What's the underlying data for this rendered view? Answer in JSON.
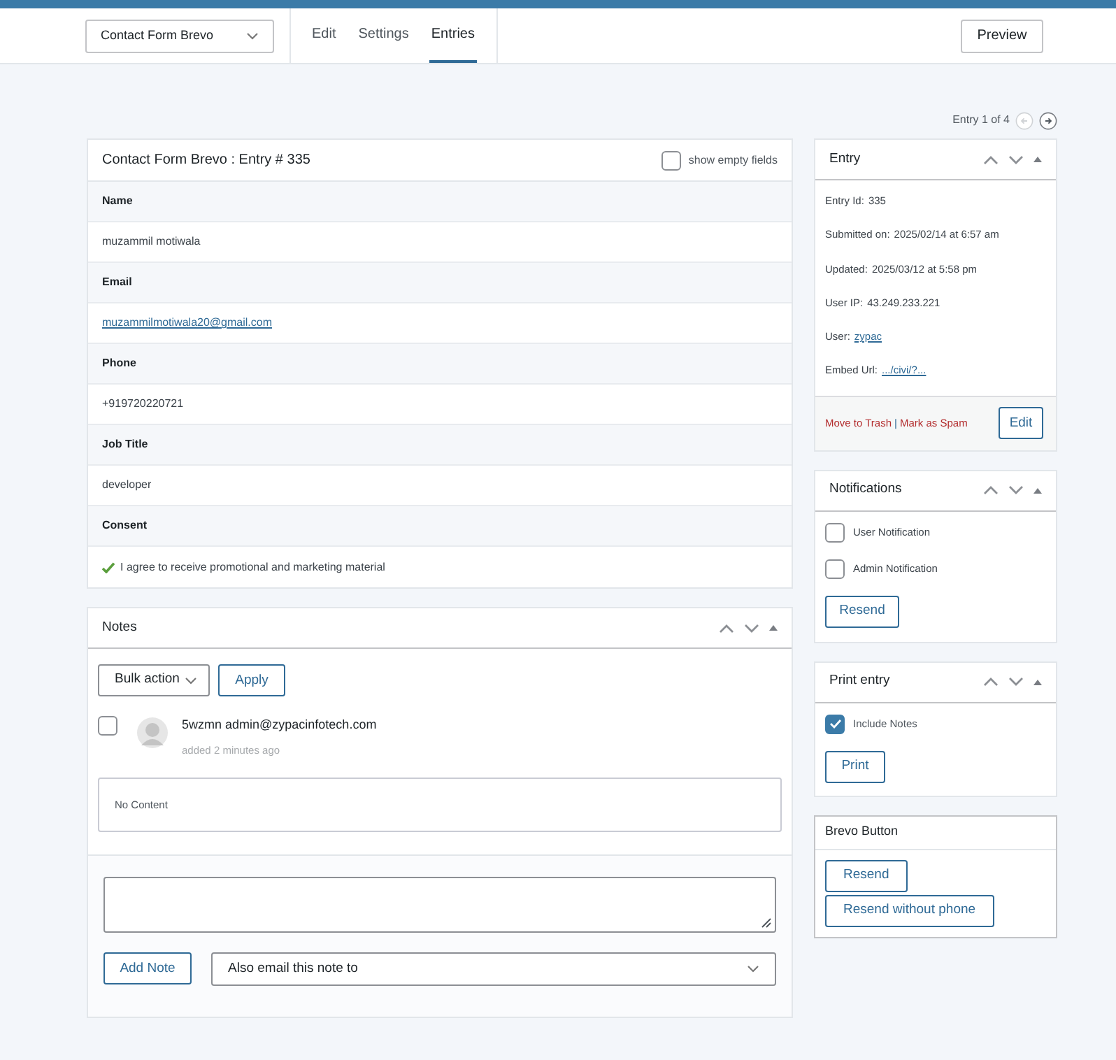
{
  "header": {
    "form_select": "Contact Form Brevo",
    "tabs": [
      {
        "label": "Edit",
        "selected": false
      },
      {
        "label": "Settings",
        "selected": false
      },
      {
        "label": "Entries",
        "selected": true
      }
    ],
    "preview_button": "Preview"
  },
  "pager": {
    "label": "Entry 1 of 4",
    "prev_disabled": true,
    "next_disabled": false
  },
  "entry_card": {
    "title": "Contact Form Brevo : Entry # 335",
    "show_empty_fields": {
      "label": "show empty fields",
      "checked": false
    },
    "fields": [
      {
        "label": "Name",
        "value": "muzammil motiwala",
        "kind": "text"
      },
      {
        "label": "Email",
        "value": "muzammilmotiwala20@gmail.com",
        "kind": "link"
      },
      {
        "label": "Phone",
        "value": "+919720220721",
        "kind": "text"
      },
      {
        "label": "Job Title",
        "value": "developer",
        "kind": "text"
      },
      {
        "label": "Consent",
        "value": "I agree to receive promotional and marketing material",
        "kind": "consent"
      }
    ]
  },
  "notes": {
    "title": "Notes",
    "bulk_action": "Bulk action",
    "apply_button": "Apply",
    "items": [
      {
        "author": "5wzmn admin@zypacinfotech.com",
        "time": "added 2 minutes ago",
        "content": "No Content",
        "checked": false
      }
    ],
    "add_note_button": "Add Note",
    "email_select": "Also email this note to"
  },
  "entry_panel": {
    "title": "Entry",
    "meta": [
      {
        "label": "Entry Id:",
        "value": "335",
        "kind": "text"
      },
      {
        "label": "Submitted on:",
        "value": "2025/02/14 at 6:57 am",
        "kind": "text"
      },
      {
        "label": "Updated:",
        "value": "2025/03/12 at 5:58 pm",
        "kind": "text"
      },
      {
        "label": "User IP:",
        "value": "43.249.233.221",
        "kind": "text"
      },
      {
        "label": "User:",
        "value": "zypac",
        "kind": "link"
      },
      {
        "label": "Embed Url:",
        "value": ".../civi/?...",
        "kind": "link"
      }
    ],
    "trash_link": "Move to Trash",
    "separator": "|",
    "spam_link": "Mark as Spam",
    "edit_button": "Edit"
  },
  "notifications_panel": {
    "title": "Notifications",
    "options": [
      {
        "label": "User Notification",
        "checked": false
      },
      {
        "label": "Admin Notification",
        "checked": false
      }
    ],
    "resend_button": "Resend"
  },
  "print_panel": {
    "title": "Print entry",
    "options": [
      {
        "label": "Include Notes",
        "checked": true
      }
    ],
    "print_button": "Print"
  },
  "brevo_panel": {
    "title": "Brevo Button",
    "buttons": [
      "Resend",
      "Resend without phone"
    ]
  }
}
